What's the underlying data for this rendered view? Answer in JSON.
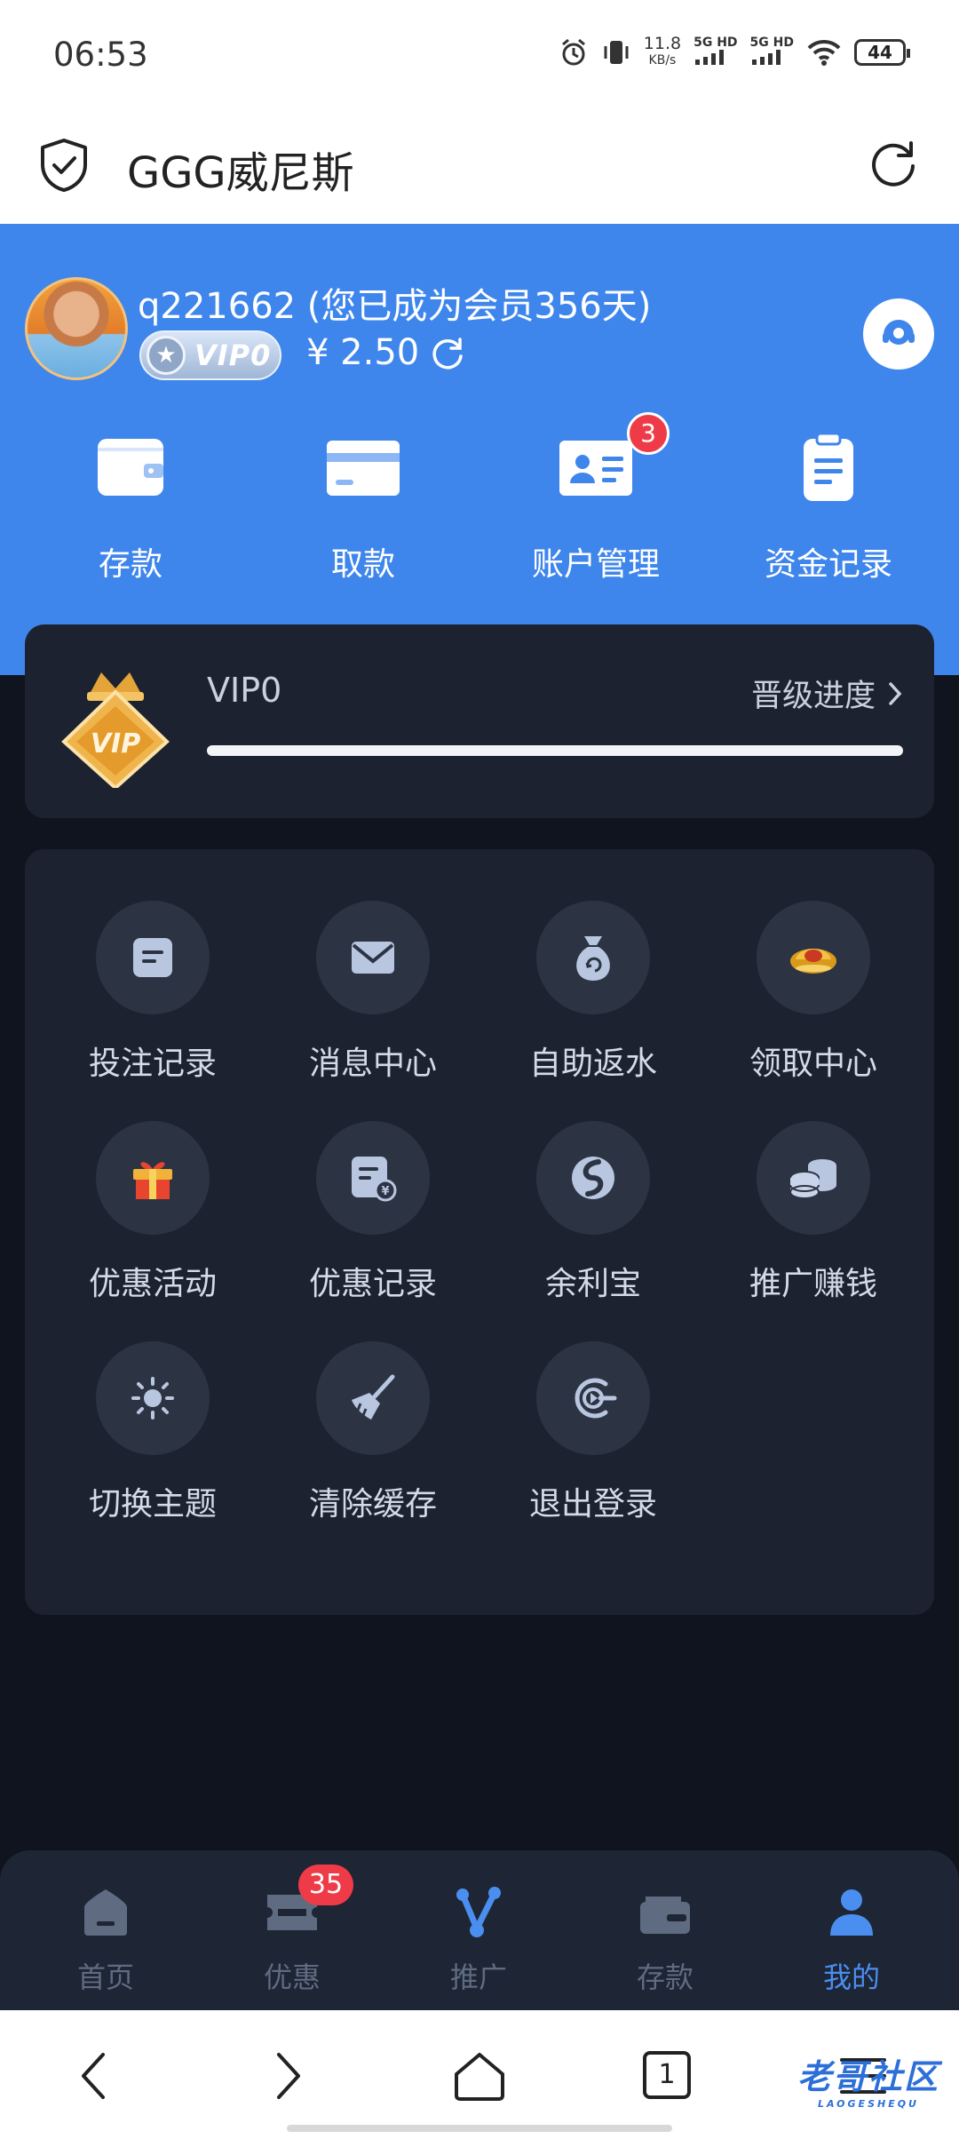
{
  "status_bar": {
    "time": "06:53",
    "speed_value": "11.8",
    "speed_unit": "KB/s",
    "sim1": "5G HD",
    "sim2": "5G HD",
    "battery": "44"
  },
  "browser": {
    "title": "GGG威尼斯"
  },
  "user": {
    "username_line": "q221662 (您已成为会员356天)",
    "vip_badge": "VIP0",
    "balance": "¥ 2.50"
  },
  "quick_actions": [
    {
      "label": "存款",
      "icon": "wallet-icon"
    },
    {
      "label": "取款",
      "icon": "card-icon"
    },
    {
      "label": "账户管理",
      "icon": "id-card-icon",
      "badge": "3"
    },
    {
      "label": "资金记录",
      "icon": "clipboard-icon"
    }
  ],
  "vip": {
    "level": "VIP0",
    "progress_link": "晋级进度",
    "progress_fraction": 0
  },
  "menu": [
    {
      "label": "投注记录",
      "icon": "bet-record-icon"
    },
    {
      "label": "消息中心",
      "icon": "envelope-icon"
    },
    {
      "label": "自助返水",
      "icon": "money-bag-icon"
    },
    {
      "label": "领取中心",
      "icon": "gold-ingot-icon"
    },
    {
      "label": "优惠活动",
      "icon": "gift-icon"
    },
    {
      "label": "优惠记录",
      "icon": "coupon-record-icon"
    },
    {
      "label": "余利宝",
      "icon": "yulibao-icon"
    },
    {
      "label": "推广赚钱",
      "icon": "coins-icon"
    },
    {
      "label": "切换主题",
      "icon": "sun-icon"
    },
    {
      "label": "清除缓存",
      "icon": "broom-icon"
    },
    {
      "label": "退出登录",
      "icon": "logout-icon"
    }
  ],
  "bottom_nav": [
    {
      "label": "首页",
      "icon": "home-icon"
    },
    {
      "label": "优惠",
      "icon": "ticket-icon",
      "badge": "35"
    },
    {
      "label": "推广",
      "icon": "share-icon"
    },
    {
      "label": "存款",
      "icon": "wallet-icon"
    },
    {
      "label": "我的",
      "icon": "user-icon",
      "active": true
    }
  ],
  "system_nav": {
    "tab_count": "1",
    "watermark": "老哥社区",
    "watermark_sub": "LAOGESHEQU"
  },
  "colors": {
    "header_blue": "#3f86ec",
    "page_bg": "#10141f",
    "card_bg": "#1c2230",
    "icon_circle": "#2c3444",
    "active_nav": "#4a8ef0",
    "badge_red": "#ef3b47"
  }
}
